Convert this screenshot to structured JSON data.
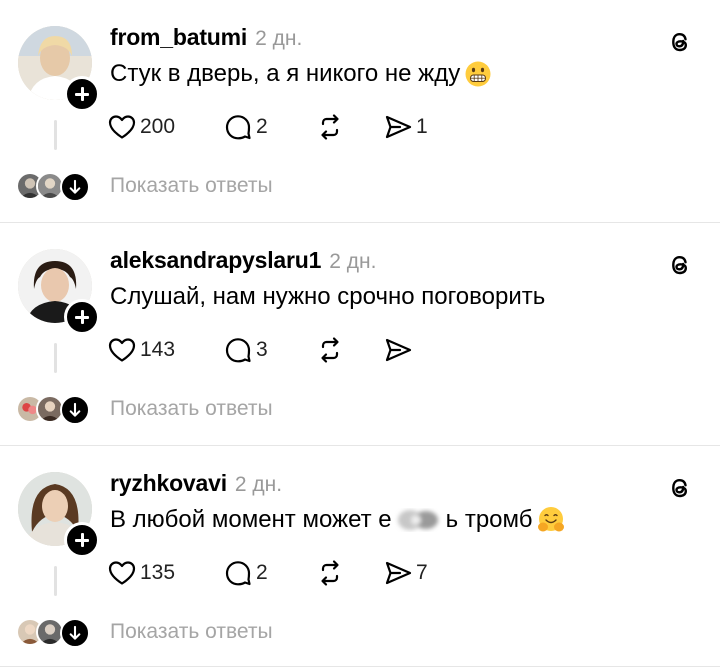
{
  "posts": [
    {
      "username": "from_batumi",
      "time": "2 дн.",
      "text": "Стук в дверь, а я никого не жду",
      "text_emoji": "grimacing-face",
      "likes": "200",
      "comments": "2",
      "shares": "1",
      "show_replies": "Показать ответы"
    },
    {
      "username": "aleksandrapyslaru1",
      "time": "2 дн.",
      "text": "Слушай, нам нужно срочно поговорить",
      "likes": "143",
      "comments": "3",
      "shares": "",
      "show_replies": "Показать ответы"
    },
    {
      "username": "ryzhkovavi",
      "time": "2 дн.",
      "text_before": "В любой момент может е",
      "text_after": "ь тромб",
      "text_emoji": "hugging-face",
      "likes": "135",
      "comments": "2",
      "shares": "7",
      "show_replies": "Показать ответы"
    }
  ]
}
